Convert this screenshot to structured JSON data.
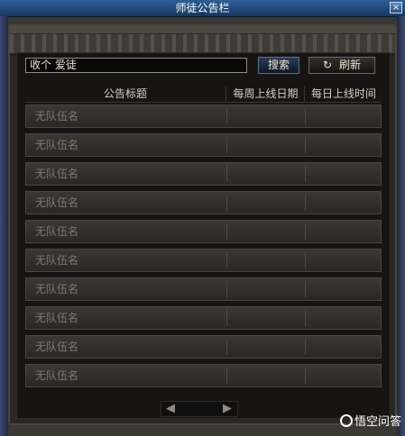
{
  "window": {
    "title": "师徒公告栏",
    "close_label": "×"
  },
  "search": {
    "value": "收个 爱徒",
    "button_label": "搜索"
  },
  "refresh": {
    "button_label": "刷新",
    "icon": "refresh-icon"
  },
  "table": {
    "headers": [
      "公告标题",
      "每周上线日期",
      "每日上线时间"
    ],
    "rows": [
      {
        "name": "无队伍名"
      },
      {
        "name": "无队伍名"
      },
      {
        "name": "无队伍名"
      },
      {
        "name": "无队伍名"
      },
      {
        "name": "无队伍名"
      },
      {
        "name": "无队伍名"
      },
      {
        "name": "无队伍名"
      },
      {
        "name": "无队伍名"
      },
      {
        "name": "无队伍名"
      },
      {
        "name": "无队伍名"
      }
    ]
  },
  "pagination": {
    "prev_icon": "◀",
    "next_icon": "▶"
  },
  "watermark": {
    "text": "悟空问答"
  }
}
